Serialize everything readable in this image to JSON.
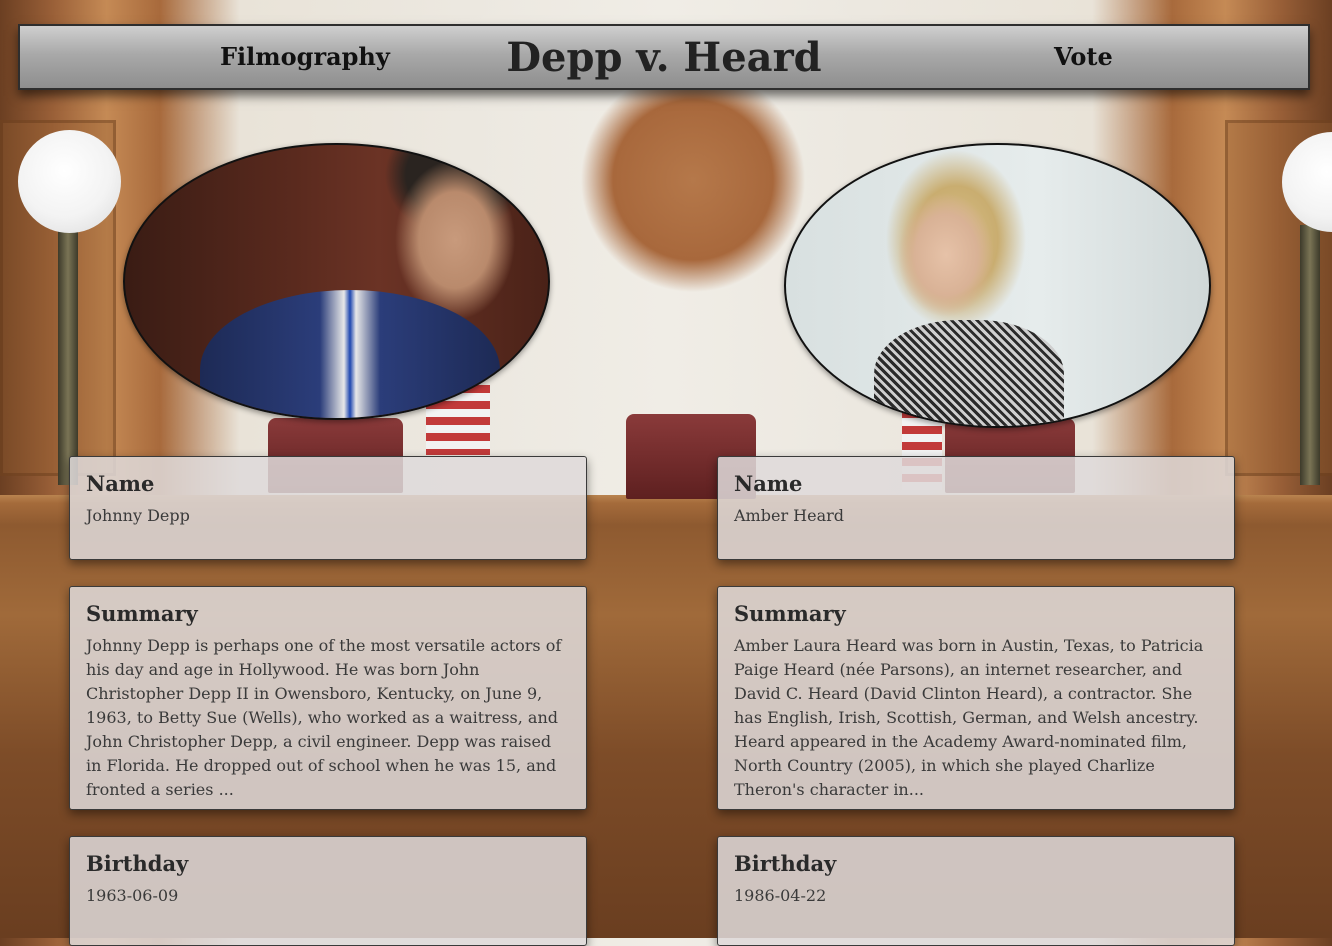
{
  "header": {
    "filmography_link": "Filmography",
    "title": "Depp v. Heard",
    "vote_link": "Vote"
  },
  "left": {
    "portrait_label": "Johnny Depp portrait",
    "name_heading": "Name",
    "name": "Johnny Depp",
    "summary_heading": "Summary",
    "summary": "Johnny Depp is perhaps one of the most versatile actors of his day and age in Hollywood. He was born John Christopher Depp II in Owensboro, Kentucky, on June 9, 1963, to Betty Sue (Wells), who worked as a waitress, and John Christopher Depp, a civil engineer. Depp was raised in Florida. He dropped out of school when he was 15, and fronted a series ...",
    "birthday_heading": "Birthday",
    "birthday": "1963-06-09"
  },
  "right": {
    "portrait_label": "Amber Heard portrait",
    "name_heading": "Name",
    "name": "Amber Heard",
    "summary_heading": "Summary",
    "summary": "Amber Laura Heard was born in Austin, Texas, to Patricia Paige Heard (née Parsons), an internet researcher, and David C. Heard (David Clinton Heard), a contractor. She has English, Irish, Scottish, German, and Welsh ancestry. Heard appeared in the Academy Award-nominated film, North Country (2005), in which she played Charlize Theron's character in...",
    "birthday_heading": "Birthday",
    "birthday": "1986-04-22"
  },
  "colors": {
    "navbar_top": "#cfcfcf",
    "navbar_bottom": "#8e8e8e",
    "card_background": "#dedada"
  }
}
